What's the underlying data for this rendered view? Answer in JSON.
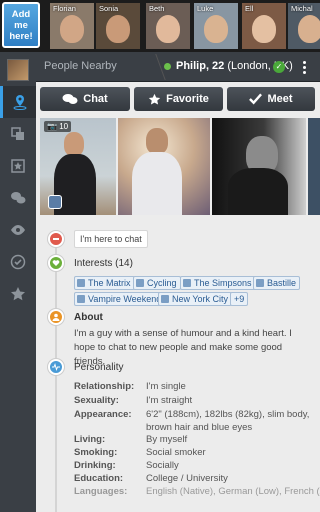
{
  "strip": {
    "add_me_label": "Add me here!",
    "users": [
      {
        "name": "Florian",
        "bg": "#8a7a6a",
        "face": "#d1a686"
      },
      {
        "name": "Sonia",
        "bg": "#5a4a3a",
        "face": "#c99a78"
      },
      {
        "name": "Beth",
        "bg": "#6b5d55",
        "face": "#e1b99b"
      },
      {
        "name": "Luke",
        "bg": "#8896a2",
        "face": "#d9b391"
      },
      {
        "name": "Ell",
        "bg": "#7d5a45",
        "face": "#e4c0a2"
      },
      {
        "name": "Michal",
        "bg": "#4f5a65",
        "face": "#d8b08f"
      }
    ]
  },
  "nav": {
    "items": [
      "my-profile",
      "people-nearby",
      "encounters",
      "favorites",
      "messages",
      "visitors",
      "activity",
      "rated"
    ]
  },
  "header": {
    "breadcrumb_root": "People Nearby",
    "profile_name": "Philip, 22",
    "profile_location": "(London, UK)"
  },
  "actions": {
    "chat_label": "Chat",
    "favorite_label": "Favorite",
    "meet_label": "Meet"
  },
  "photos": {
    "count": "10"
  },
  "status": {
    "text": "I'm here to chat"
  },
  "interests": {
    "title": "Interests (14)",
    "tags": [
      "The Matrix",
      "Cycling",
      "The Simpsons",
      "Bastille",
      "Vampire Weekend",
      "New York City"
    ],
    "more": "+9"
  },
  "about": {
    "title": "About",
    "text": "I'm a guy with a sense of humour and a kind heart. I hope to chat to new people and make some good friends."
  },
  "personality": {
    "title": "Personality",
    "rows": [
      {
        "label": "Relationship:",
        "value": "I'm single"
      },
      {
        "label": "Sexuality:",
        "value": "I'm straight"
      },
      {
        "label": "Appearance:",
        "value": "6'2\" (188cm), 182lbs (82kg), slim body, brown hair and blue eyes"
      },
      {
        "label": "Living:",
        "value": "By myself"
      },
      {
        "label": "Smoking:",
        "value": "Social smoker"
      },
      {
        "label": "Drinking:",
        "value": "Socially"
      },
      {
        "label": "Education:",
        "value": "College / University"
      },
      {
        "label": "Languages:",
        "value": "English (Native), German (Low), French (Ave"
      }
    ]
  },
  "colors": {
    "accent_blue": "#2f7fc4",
    "online_green": "#6bc04b",
    "tag_text": "#2a5c93"
  }
}
